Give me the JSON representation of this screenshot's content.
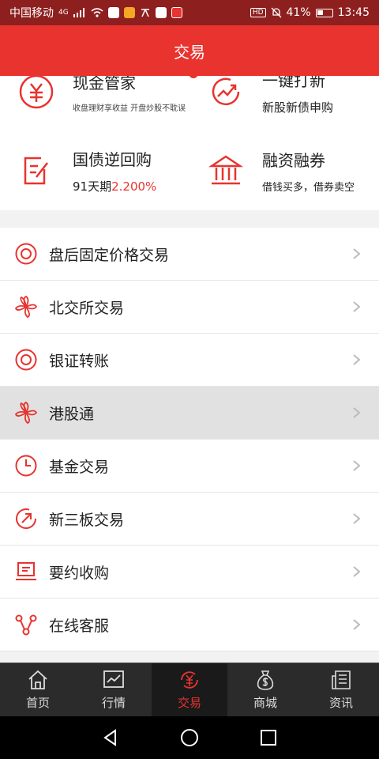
{
  "status_bar": {
    "carrier": "中国移动",
    "network": "4G",
    "battery": "41%",
    "time": "13:45",
    "hd": "HD"
  },
  "header": {
    "title": "交易"
  },
  "grid": [
    {
      "title": "现金管家",
      "subtitle": "收盘理财享收益 开盘炒股不耽误",
      "icon": "yen-circle-icon"
    },
    {
      "title": "一键打新",
      "subtitle": "新股新债申购",
      "icon": "growth-chart-icon"
    },
    {
      "title": "国债逆回购",
      "subtitle_prefix": "91天期",
      "subtitle_rate": "2.200%",
      "icon": "edit-document-icon"
    },
    {
      "title": "融资融券",
      "subtitle": "借钱买多，借券卖空",
      "icon": "bank-building-icon"
    }
  ],
  "menu": [
    {
      "label": "盘后固定价格交易",
      "icon": "at-circle-icon"
    },
    {
      "label": "北交所交易",
      "icon": "bauhinia-icon"
    },
    {
      "label": "银证转账",
      "icon": "at-circle-icon"
    },
    {
      "label": "港股通",
      "icon": "bauhinia-icon",
      "active": true
    },
    {
      "label": "基金交易",
      "icon": "clock-icon"
    },
    {
      "label": "新三板交易",
      "icon": "arrow-circle-icon"
    },
    {
      "label": "要约收购",
      "icon": "laptop-icon"
    },
    {
      "label": "在线客服",
      "icon": "share-nodes-icon"
    }
  ],
  "bottom_nav": [
    {
      "label": "首页",
      "icon": "home-icon"
    },
    {
      "label": "行情",
      "icon": "chart-icon"
    },
    {
      "label": "交易",
      "icon": "yen-cycle-icon",
      "active": true
    },
    {
      "label": "商城",
      "icon": "money-bag-icon"
    },
    {
      "label": "资讯",
      "icon": "news-icon"
    }
  ],
  "colors": {
    "accent": "#e8332f",
    "status_bar": "#8e1f1f",
    "nav_bg": "#2b2b2b"
  }
}
